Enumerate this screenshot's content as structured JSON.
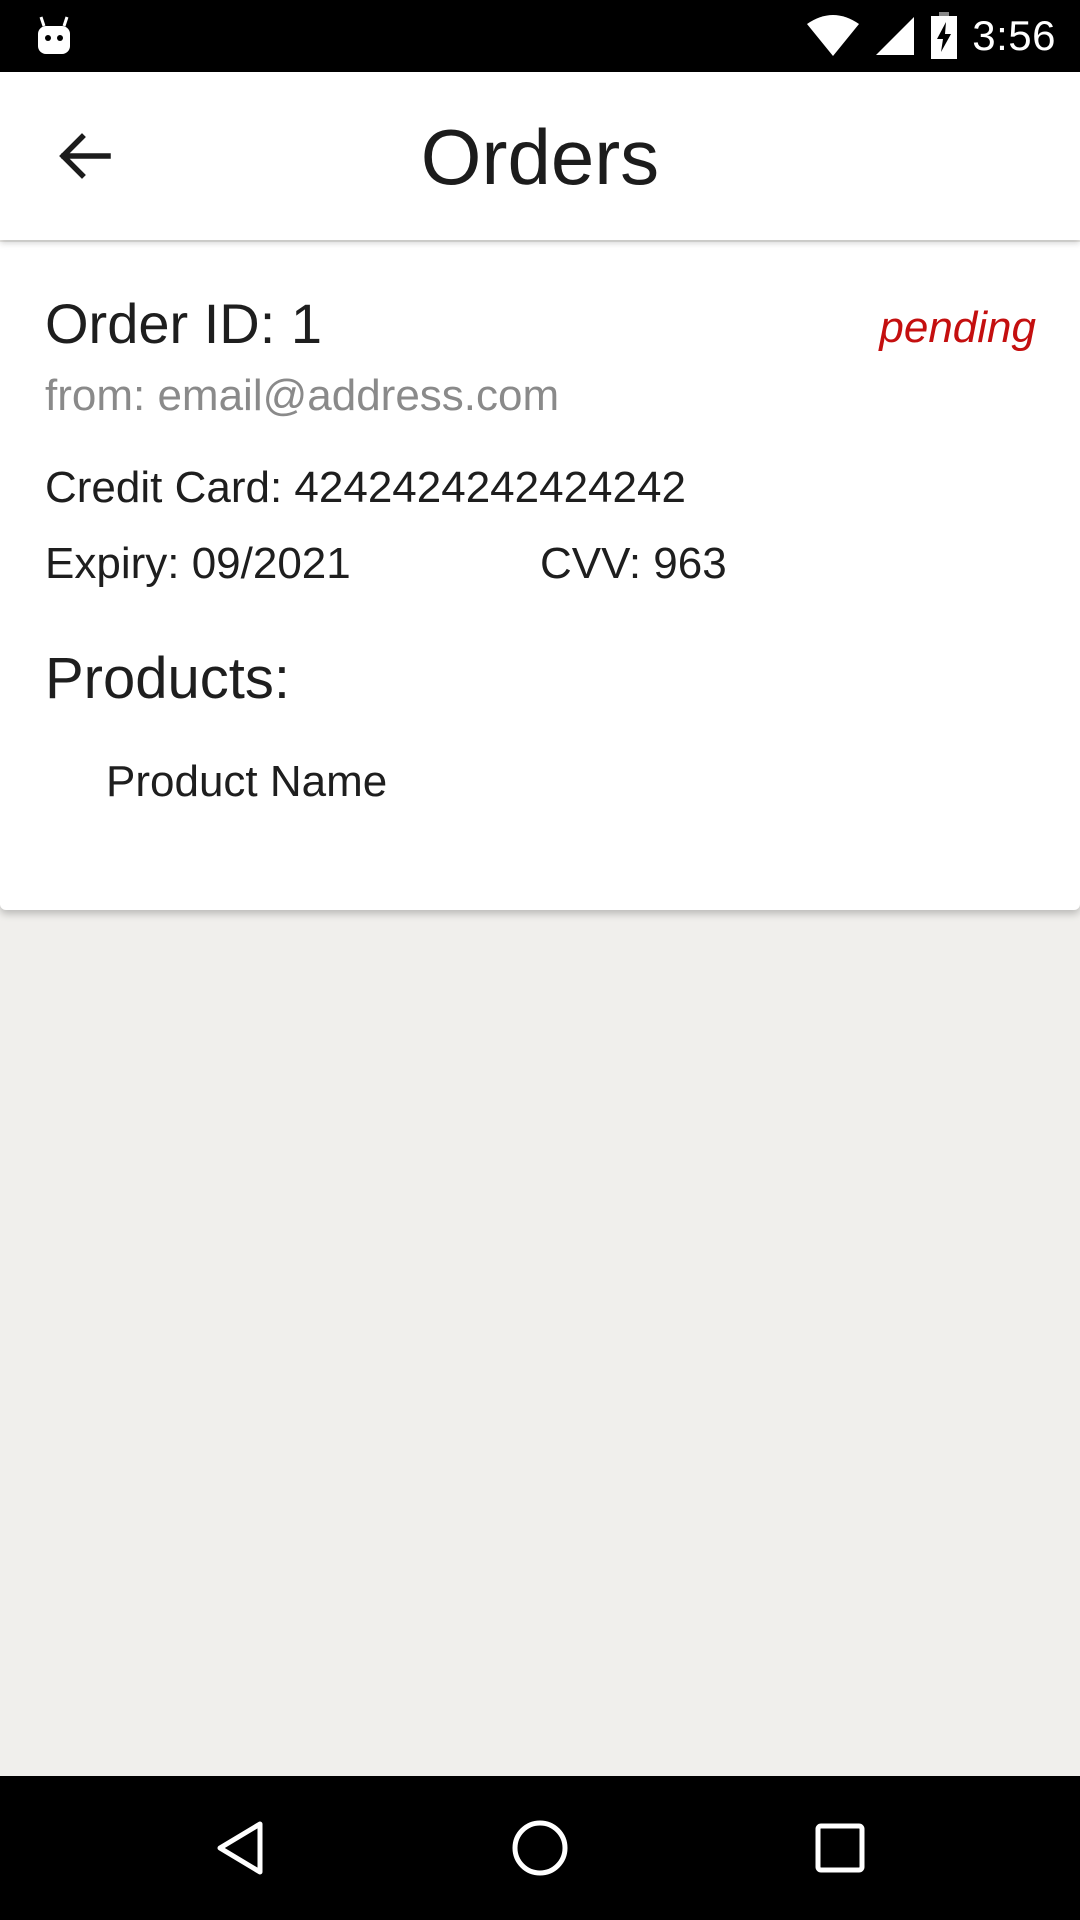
{
  "status_bar": {
    "time": "3:56",
    "icons": [
      "android-debug-icon",
      "wifi-icon",
      "cell-signal-icon",
      "battery-charging-icon"
    ]
  },
  "app_bar": {
    "title": "Orders",
    "back_icon": "arrow-back-icon"
  },
  "order": {
    "id_label": "Order ID: 1",
    "status": "pending",
    "status_color": "#c40f0f",
    "from": "from: email@address.com",
    "credit_card": "Credit Card: 4242424242424242",
    "expiry": "Expiry: 09/2021",
    "cvv": "CVV: 963",
    "products_heading": "Products:",
    "products": [
      "Product Name"
    ]
  },
  "nav_bar": {
    "icons": [
      "nav-back-icon",
      "nav-home-icon",
      "nav-recents-icon"
    ]
  }
}
